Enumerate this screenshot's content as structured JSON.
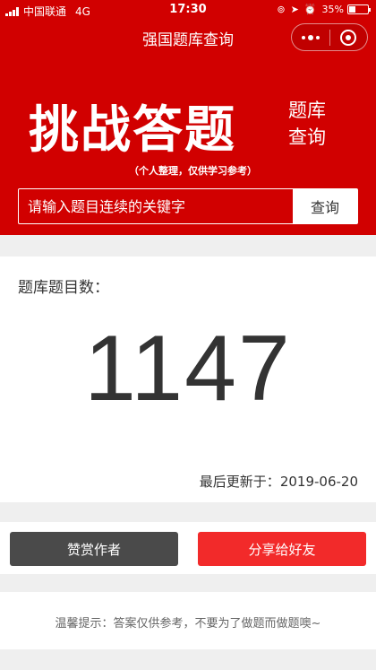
{
  "status_bar": {
    "carrier": "中国联通",
    "network": "4G",
    "time": "17:30",
    "battery": "35%",
    "battery_level": 0.35
  },
  "nav": {
    "title": "强国题库查询"
  },
  "hero": {
    "title": "挑战答题",
    "side_title": "题库查询",
    "subtitle": "（个人整理，仅供学习参考）"
  },
  "search": {
    "placeholder": "请输入题目连续的关键字",
    "button_label": "查询"
  },
  "stats": {
    "label": "题库题目数：",
    "count": "1147",
    "updated_label": "最后更新于：",
    "updated_date": "2019-06-20"
  },
  "actions": {
    "reward_label": "赞赏作者",
    "share_label": "分享给好友"
  },
  "tip": {
    "text": "温馨提示：答案仅供参考，不要为了做题而做题噢~"
  },
  "colors": {
    "brand_red": "#d10000",
    "share_red": "#f22a2a",
    "reward_gray": "#4a4a4a"
  }
}
